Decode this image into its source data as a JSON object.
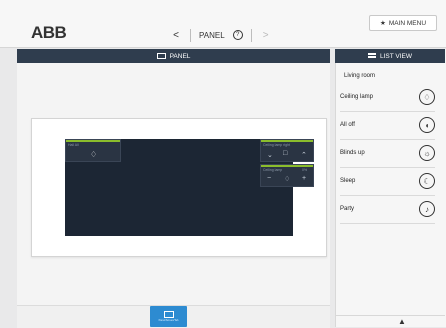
{
  "header": {
    "logo": "ABB",
    "nav": {
      "prev": "<",
      "title": "PANEL",
      "help": "?",
      "next": ">"
    },
    "main_menu": "MAIN MENU"
  },
  "panel": {
    "title": "PANEL",
    "tiles": {
      "left": {
        "label": "Hall All",
        "icon": "bulb-icon"
      },
      "right_top": {
        "label": "Ceiling lamp right"
      },
      "right_bottom": {
        "label": "Ceiling lamp",
        "value": "0%"
      }
    },
    "bottom": {
      "panel_button": "Panel/Screen/Tab"
    }
  },
  "list_view": {
    "title": "LIST VIEW",
    "group": "Living room",
    "items": [
      {
        "label": "Ceiling lamp",
        "icon": "bulb-icon"
      },
      {
        "label": "All off",
        "icon": "door-icon"
      },
      {
        "label": "Blinds up",
        "icon": "sun-icon"
      },
      {
        "label": "Sleep",
        "icon": "moon-icon"
      },
      {
        "label": "Party",
        "icon": "party-icon"
      }
    ],
    "footer": "▲"
  }
}
